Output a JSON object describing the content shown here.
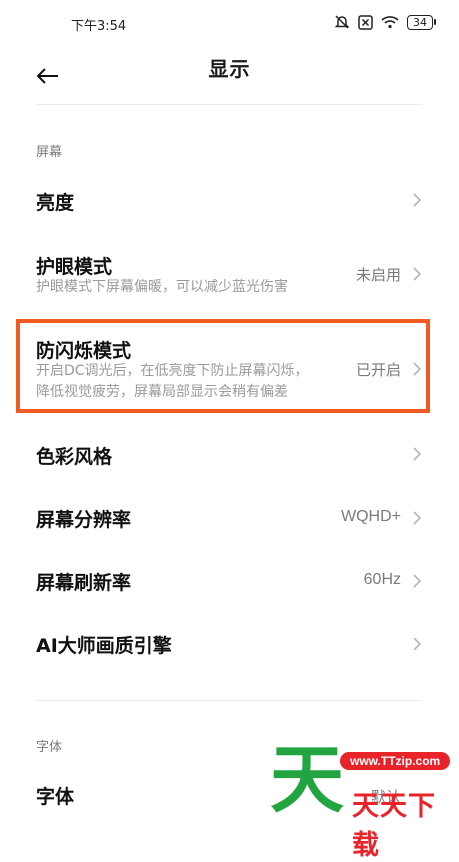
{
  "status": {
    "time": "下午3:54",
    "battery": "34"
  },
  "header": {
    "title": "显示"
  },
  "sections": {
    "screen_label": "屏幕",
    "font_label": "字体"
  },
  "rows": {
    "brightness": {
      "title": "亮度"
    },
    "eye_care": {
      "title": "护眼模式",
      "subtitle": "护眼模式下屏幕偏暖，可以减少蓝光伤害",
      "value": "未启用"
    },
    "anti_flicker": {
      "title": "防闪烁模式",
      "subtitle_line1": "开启DC调光后，在低亮度下防止屏幕闪烁，",
      "subtitle_line2": "降低视觉疲劳，屏幕局部显示会稍有偏差",
      "value": "已开启"
    },
    "color_style": {
      "title": "色彩风格"
    },
    "resolution": {
      "title": "屏幕分辨率",
      "value": "WQHD+"
    },
    "refresh_rate": {
      "title": "屏幕刷新率",
      "value": "60Hz"
    },
    "ai_engine": {
      "title": "AI大师画质引擎"
    },
    "font": {
      "title": "字体",
      "value": "默认"
    }
  },
  "watermark": {
    "big_char": "天",
    "url": "www.TTzip.com",
    "text": "天天下载"
  },
  "colors": {
    "highlight": "#f05a23",
    "watermark_green": "#22a541",
    "watermark_red": "#e8242a"
  }
}
